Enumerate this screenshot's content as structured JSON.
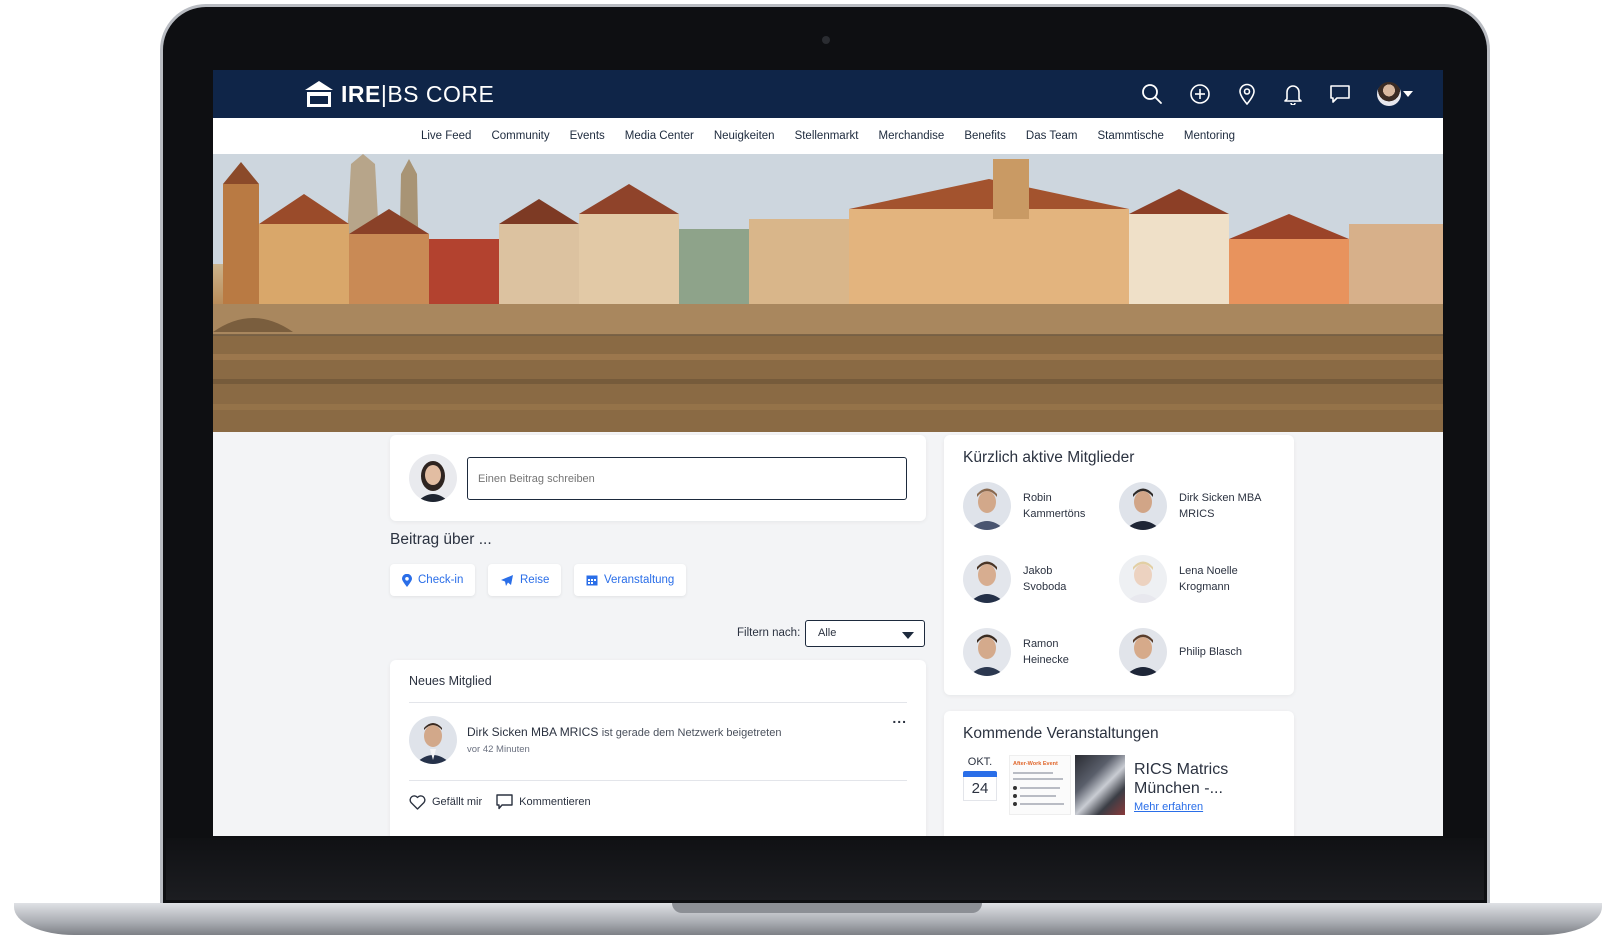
{
  "app": {
    "logo_text_bold": "IRE",
    "logo_text_rest": "|BS CORE"
  },
  "nav": {
    "items": [
      "Live Feed",
      "Community",
      "Events",
      "Media Center",
      "Neuigkeiten",
      "Stellenmarkt",
      "Merchandise",
      "Benefits",
      "Das Team",
      "Stammtische",
      "Mentoring"
    ]
  },
  "composer": {
    "placeholder": "Einen Beitrag schreiben"
  },
  "post_about": {
    "label": "Beitrag über ...",
    "chips": [
      "Check-in",
      "Reise",
      "Veranstaltung"
    ]
  },
  "filter": {
    "label": "Filtern nach:",
    "value": "Alle"
  },
  "feed": {
    "card_title": "Neues Mitglied",
    "author": "Dirk Sicken MBA MRICS",
    "action_text": "ist gerade dem Netzwerk beigetreten",
    "time": "vor 42 Minuten",
    "like_label": "Gefällt mir",
    "comment_label": "Kommentieren",
    "more": "..."
  },
  "members": {
    "title": "Kürzlich aktive Mitglieder",
    "list": [
      {
        "line1": "Robin",
        "line2": "Kammertöns"
      },
      {
        "line1": "Dirk Sicken MBA",
        "line2": "MRICS"
      },
      {
        "line1": "Jakob",
        "line2": "Svoboda"
      },
      {
        "line1": "Lena Noelle",
        "line2": "Krogmann"
      },
      {
        "line1": "Ramon",
        "line2": "Heinecke"
      },
      {
        "line1": "Philip Blasch",
        "line2": ""
      }
    ]
  },
  "events": {
    "title": "Kommende Veranstaltungen",
    "month": "OKT.",
    "day": "24",
    "flyer_title": "After-Work Event",
    "event_title_line1": "RICS Matrics",
    "event_title_line2": "München -...",
    "link": "Mehr erfahren"
  },
  "colors": {
    "header_bg": "#0f2548",
    "accent_blue": "#2a6ee8",
    "text_dark": "#2b3240"
  },
  "icons": [
    "search-icon",
    "plus-circle-icon",
    "location-pin-icon",
    "bell-icon",
    "chat-icon",
    "heart-icon",
    "comment-icon",
    "map-marker-icon",
    "plane-icon",
    "calendar-icon"
  ]
}
